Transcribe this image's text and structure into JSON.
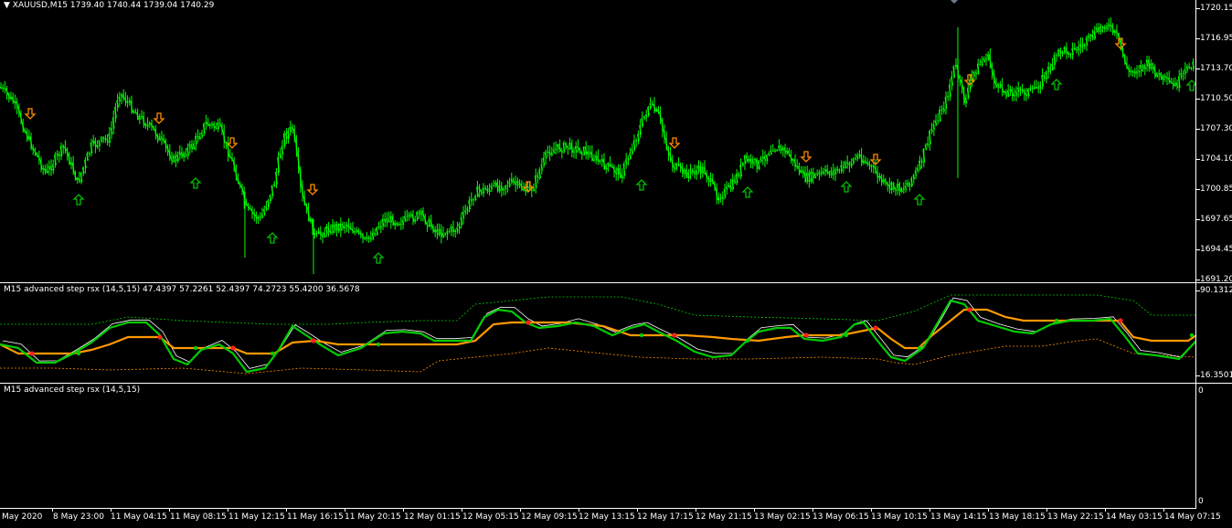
{
  "main_chart": {
    "symbol_label": "XAUUSD,M15",
    "ohlc_label": "1739.40 1740.44 1739.04 1740.29",
    "price_axis": [
      "1720.15",
      "1716.95",
      "1713.70",
      "1710.50",
      "1707.30",
      "1704.10",
      "1700.85",
      "1697.65",
      "1694.45",
      "1691.20"
    ],
    "candle_color": "#00ff00",
    "buy_arrow_color": "#00c000",
    "sell_arrow_color": "#ff8c00"
  },
  "indicator_1": {
    "label": "M15 advanced step rsx (14,5,15) 47.4397 57.2261 52.4397 74.2723 55.4200 36.5678",
    "axis_top": "90.1312",
    "axis_bottom": "16.3501",
    "fast_color": "#00cc00",
    "slow_color": "#ff9900",
    "signal_dot_color": "#ff2020"
  },
  "indicator_2": {
    "label": "M15 advanced step rsx (14,5,15)",
    "axis_top": "0",
    "axis_bottom": "0"
  },
  "time_axis": [
    "May 2020",
    "8 May 23:00",
    "11 May 04:15",
    "11 May 08:15",
    "11 May 12:15",
    "11 May 16:15",
    "11 May 20:15",
    "12 May 01:15",
    "12 May 05:15",
    "12 May 09:15",
    "12 May 13:15",
    "12 May 17:15",
    "12 May 21:15",
    "13 May 02:15",
    "13 May 06:15",
    "13 May 10:15",
    "13 May 14:15",
    "13 May 18:15",
    "13 May 22:15",
    "14 May 03:15",
    "14 May 07:15"
  ]
}
